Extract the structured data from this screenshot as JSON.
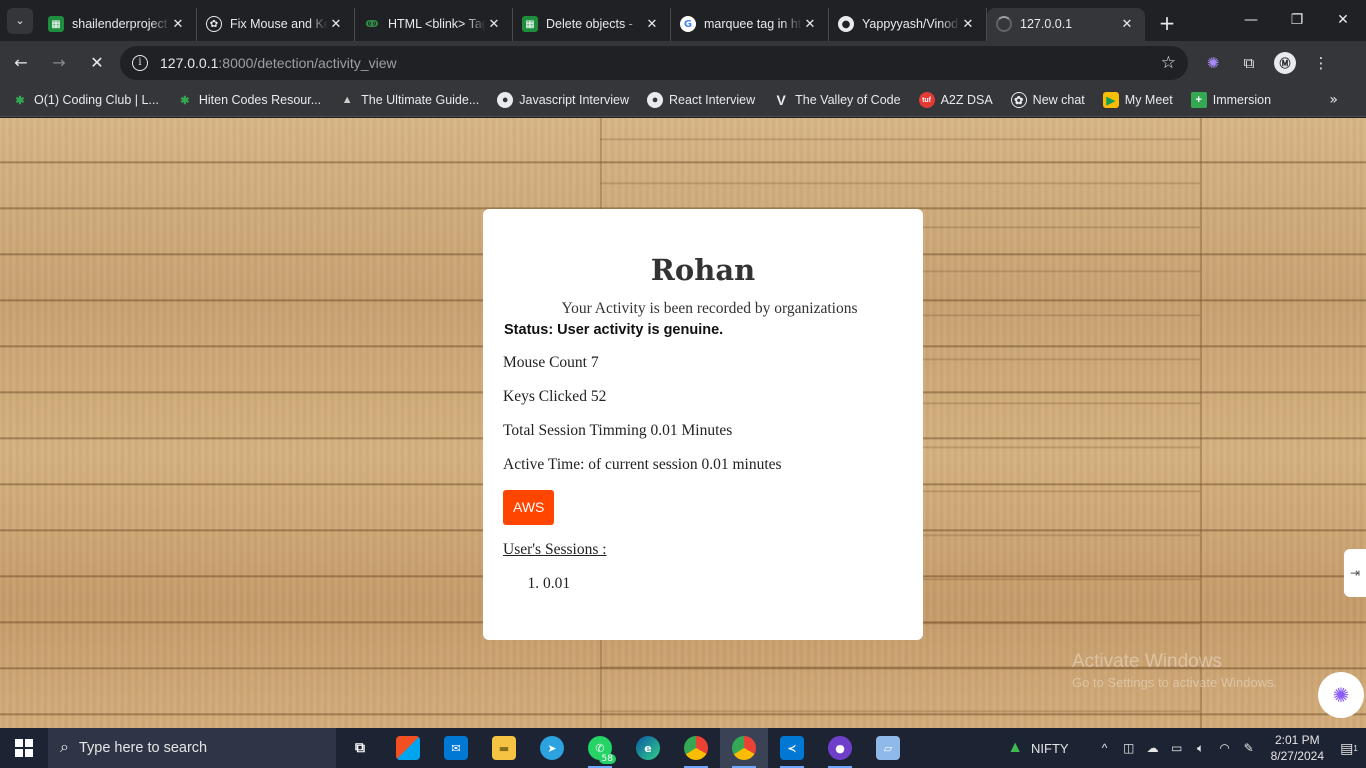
{
  "browser": {
    "tabs": [
      {
        "title": "shailenderproject",
        "icon": "sheets-icon",
        "color": "#1e8e3e"
      },
      {
        "title": "Fix Mouse and Keys",
        "icon": "chatgpt-icon",
        "color": "#e8eaed"
      },
      {
        "title": "HTML <blink> Tag",
        "icon": "geeksforgeeks-icon",
        "color": "#2f8d46"
      },
      {
        "title": "Delete objects - ",
        "icon": "sheets-icon",
        "color": "#1e8e3e"
      },
      {
        "title": "marquee tag in html",
        "icon": "google-icon",
        "color": "#4285f4"
      },
      {
        "title": "Yappyyash/Vinod",
        "icon": "github-icon",
        "color": "#e8eaed"
      },
      {
        "title": "127.0.0.1",
        "icon": "loading-icon",
        "color": "#9aa0a6"
      }
    ],
    "url_host": "127.0.0.1",
    "url_path": ":8000/detection/activity_view",
    "bookmarks": [
      {
        "label": "O(1) Coding Club | L...",
        "icon": "asterisk-icon",
        "color": "#34a853"
      },
      {
        "label": "Hiten Codes Resour...",
        "icon": "asterisk-icon",
        "color": "#34a853"
      },
      {
        "label": "The Ultimate Guide...",
        "icon": "mountain-icon",
        "color": "#cccccc"
      },
      {
        "label": "Javascript Interview",
        "icon": "github-icon",
        "color": "#e8eaed"
      },
      {
        "label": "React Interview",
        "icon": "github-icon",
        "color": "#e8eaed"
      },
      {
        "label": "The Valley of Code",
        "icon": "v-icon",
        "color": "#e8eaed"
      },
      {
        "label": "A2Z DSA",
        "icon": "tuf-icon",
        "color": "#e53935"
      },
      {
        "label": "New chat",
        "icon": "chatgpt-icon",
        "color": "#e8eaed"
      },
      {
        "label": "My Meet",
        "icon": "meet-icon",
        "color": "#fbbc04"
      },
      {
        "label": "Immersion",
        "icon": "plus-icon",
        "color": "#34a853"
      }
    ]
  },
  "card": {
    "name": "Rohan",
    "subtitle": "Your Activity is been recorded by organizations",
    "status": "Status: User activity is genuine.",
    "mouse_count": "Mouse Count 7",
    "keys_clicked": "Keys Clicked 52",
    "total_session": "Total Session Timming 0.01 Minutes",
    "active_time": "Active Time: of current session 0.01 minutes",
    "aws_label": "AWS",
    "aws_color": "#ff4500",
    "sessions_heading": "User's Sessions :",
    "sessions": [
      "0.01"
    ]
  },
  "watermark": {
    "line1": "Activate Windows",
    "line2": "Go to Settings to activate Windows."
  },
  "taskbar": {
    "search_placeholder": "Type here to search",
    "whatsapp_badge": "58",
    "ticker": "NIFTY",
    "time": "2:01 PM",
    "date": "8/27/2024",
    "notification_count": "1"
  }
}
